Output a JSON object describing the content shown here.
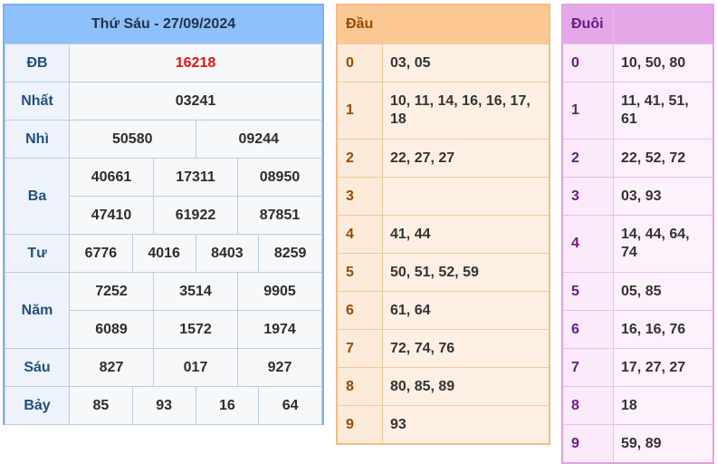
{
  "results": {
    "title": "Thứ Sáu - 27/09/2024",
    "prizes": [
      {
        "label": "ĐB",
        "values": [
          "16218"
        ]
      },
      {
        "label": "Nhất",
        "values": [
          "03241"
        ]
      },
      {
        "label": "Nhì",
        "values": [
          "50580",
          "09244"
        ]
      },
      {
        "label": "Ba",
        "values": [
          "40661",
          "17311",
          "08950",
          "47410",
          "61922",
          "87851"
        ]
      },
      {
        "label": "Tư",
        "values": [
          "6776",
          "4016",
          "8403",
          "8259"
        ]
      },
      {
        "label": "Năm",
        "values": [
          "7252",
          "3514",
          "9905",
          "6089",
          "1572",
          "1974"
        ]
      },
      {
        "label": "Sáu",
        "values": [
          "827",
          "017",
          "927"
        ]
      },
      {
        "label": "Bảy",
        "values": [
          "85",
          "93",
          "16",
          "64"
        ]
      }
    ]
  },
  "dau": {
    "header": "Đầu",
    "rows": [
      {
        "k": "0",
        "v": "03, 05"
      },
      {
        "k": "1",
        "v": "10, 11, 14, 16, 16, 17, 18"
      },
      {
        "k": "2",
        "v": "22, 27, 27"
      },
      {
        "k": "3",
        "v": ""
      },
      {
        "k": "4",
        "v": "41, 44"
      },
      {
        "k": "5",
        "v": "50, 51, 52, 59"
      },
      {
        "k": "6",
        "v": "61, 64"
      },
      {
        "k": "7",
        "v": "72, 74, 76"
      },
      {
        "k": "8",
        "v": "80, 85, 89"
      },
      {
        "k": "9",
        "v": "93"
      }
    ]
  },
  "duoi": {
    "header": "Đuôi",
    "rows": [
      {
        "k": "0",
        "v": "10, 50, 80"
      },
      {
        "k": "1",
        "v": "11, 41, 51, 61"
      },
      {
        "k": "2",
        "v": "22, 52, 72"
      },
      {
        "k": "3",
        "v": "03, 93"
      },
      {
        "k": "4",
        "v": "14, 44, 64, 74"
      },
      {
        "k": "5",
        "v": "05, 85"
      },
      {
        "k": "6",
        "v": "16, 16, 76"
      },
      {
        "k": "7",
        "v": "17, 27, 27"
      },
      {
        "k": "8",
        "v": "18"
      },
      {
        "k": "9",
        "v": "59, 89"
      }
    ]
  },
  "colors": {
    "special_prize": "#e01414",
    "results_header": "#8ec0fb",
    "dau_header": "#fbc894",
    "duoi_header": "#e4a8e8"
  }
}
